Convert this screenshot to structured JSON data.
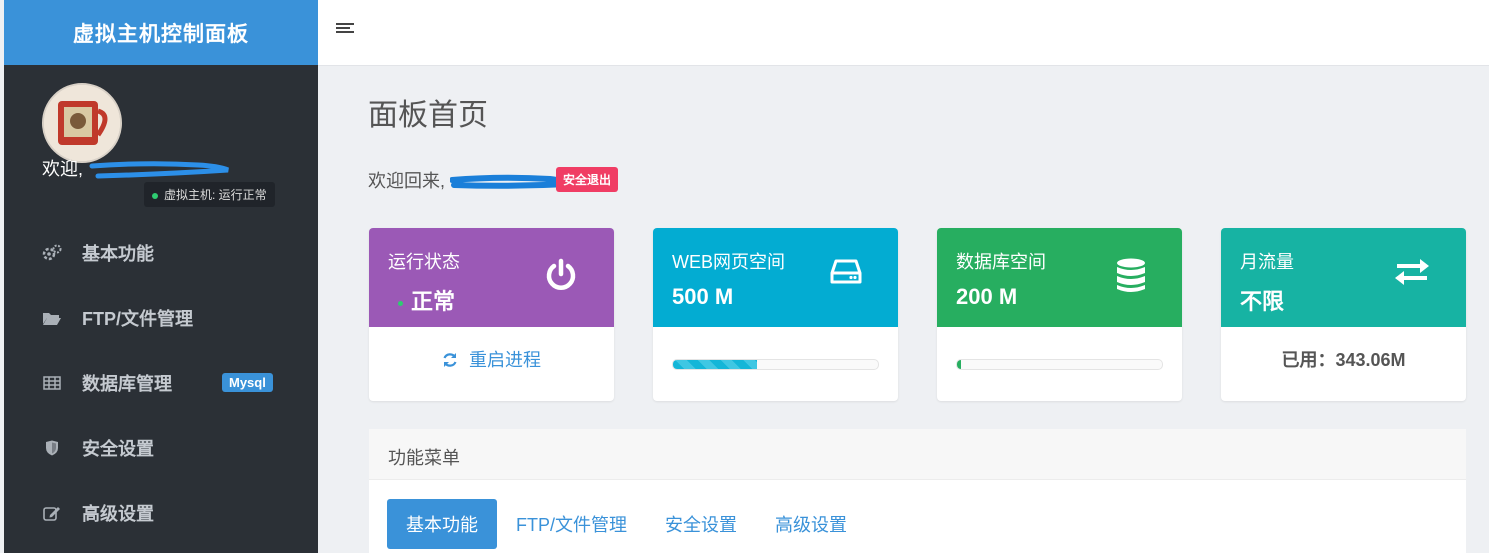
{
  "sidebar": {
    "brand": "虚拟主机控制面板",
    "welcome_prefix": "欢迎,",
    "status": "虚拟主机: 运行正常",
    "items": [
      {
        "label": "基本功能",
        "icon": "gears-icon"
      },
      {
        "label": "FTP/文件管理",
        "icon": "folder-open-icon"
      },
      {
        "label": "数据库管理",
        "icon": "table-icon",
        "badge": "Mysql"
      },
      {
        "label": "安全设置",
        "icon": "shield-icon"
      },
      {
        "label": "高级设置",
        "icon": "edit-icon"
      }
    ]
  },
  "topbar": {
    "menu_icon": "hamburger-icon"
  },
  "main": {
    "page_title": "面板首页",
    "welcome_back": "欢迎回来,",
    "logout_label": "安全退出",
    "cards": [
      {
        "label": "运行状态",
        "value": "正常",
        "icon": "power-icon",
        "color": "#9b59b6",
        "action": "重启进程"
      },
      {
        "label": "WEB网页空间",
        "value": "500 M",
        "icon": "hdd-icon",
        "color": "#03acd2",
        "usage_percent": 41
      },
      {
        "label": "数据库空间",
        "value": "200 M",
        "icon": "database-icon",
        "color": "#27ae60",
        "usage_percent": 2
      },
      {
        "label": "月流量",
        "value": "不限",
        "icon": "exchange-icon",
        "color": "#17b3a3",
        "used": "已用：343.06M"
      }
    ],
    "menu": {
      "title": "功能菜单",
      "tabs": [
        "基本功能",
        "FTP/文件管理",
        "安全设置",
        "高级设置"
      ]
    }
  }
}
